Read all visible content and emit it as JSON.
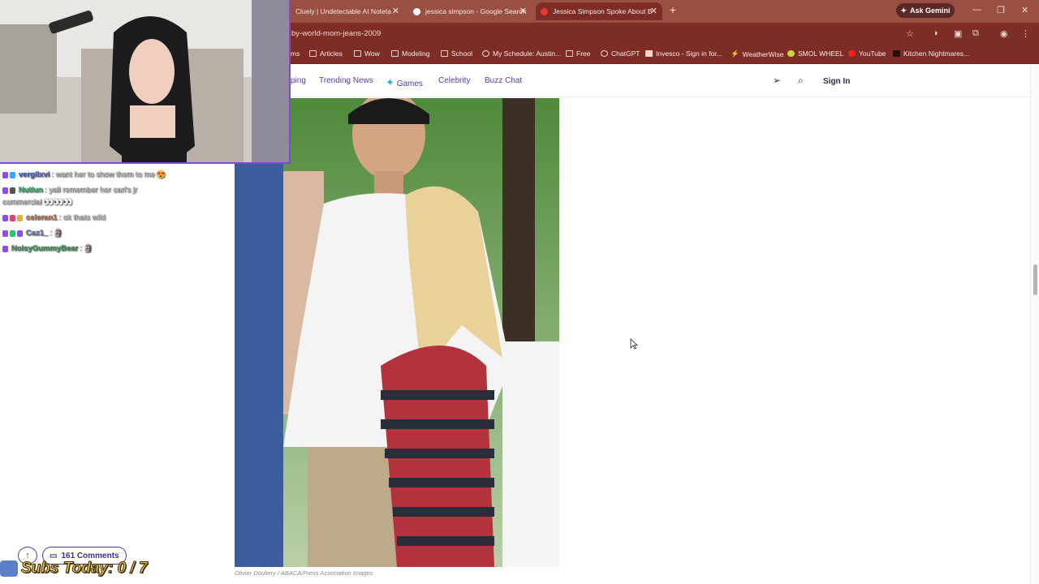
{
  "browser": {
    "tabs": [
      {
        "title": "Cluely | Undetectable AI Noteta"
      },
      {
        "title": "jessica simpson - Google Search"
      },
      {
        "title": "Jessica Simpson Spoke About B"
      }
    ],
    "ask_gemini": "Ask Gemini",
    "url": "by-world-mom-jeans-2009",
    "bookmarks": [
      "ms",
      "Articles",
      "Wow",
      "Modeling",
      "School",
      "My Schedule: Austin...",
      "Free",
      "ChatGPT",
      "Invesco - Sign in for...",
      "WeatherWise",
      "SMOL WHEEL",
      "YouTube",
      "Kitchen Nightmares..."
    ]
  },
  "site": {
    "nav": [
      "ping",
      "Trending News",
      "Games",
      "Celebrity",
      "Buzz Chat"
    ],
    "sign_in": "Sign In",
    "photo_credit": "Olivier Douliery / ABACA/Press Association Images",
    "comments_label": "161 Comments"
  },
  "stream": {
    "chat": [
      {
        "user": "vergilxvi",
        "text": ": want her to show them to me",
        "emoji": "😍",
        "user_color": "#3b5bdb"
      },
      {
        "user": "Nutlun",
        "text": ": yall remember her carl's jr",
        "text2": "commercial 👀👀👀",
        "emoji": "",
        "user_color": "#2fbf71"
      },
      {
        "user": "celeran1",
        "text": ": ok thats wild",
        "emoji": "",
        "user_color": "#d9824a"
      },
      {
        "user": "Caz1_",
        "text": ":",
        "emoji": "🗿",
        "user_color": "#6b7fd7"
      },
      {
        "user": "NoisyGummyBear",
        "text": ":",
        "emoji": "🗿",
        "user_color": "#2fa84f"
      }
    ],
    "subs_today": "Subs Today: 0 / 7"
  }
}
